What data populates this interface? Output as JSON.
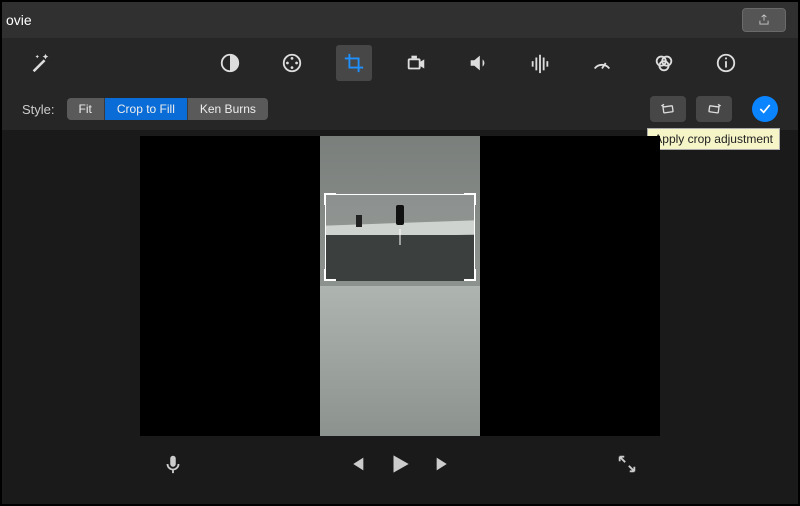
{
  "titlebar": {
    "title": "ovie"
  },
  "toolbar": {
    "tools": [
      "enhance",
      "color-balance",
      "color-wheel",
      "crop",
      "stabilize",
      "volume",
      "noise-reduction",
      "speed",
      "color-correct",
      "info"
    ],
    "active": "crop"
  },
  "styleRow": {
    "label": "Style:",
    "options": [
      "Fit",
      "Crop to Fill",
      "Ken Burns"
    ],
    "active": 1,
    "rightButtons": [
      "rotate-ccw",
      "rotate-cw"
    ],
    "apply": {
      "tooltip": "Apply crop adjustment"
    }
  },
  "transport": {
    "buttons": [
      "mic",
      "prev",
      "play",
      "next",
      "fullscreen"
    ]
  }
}
